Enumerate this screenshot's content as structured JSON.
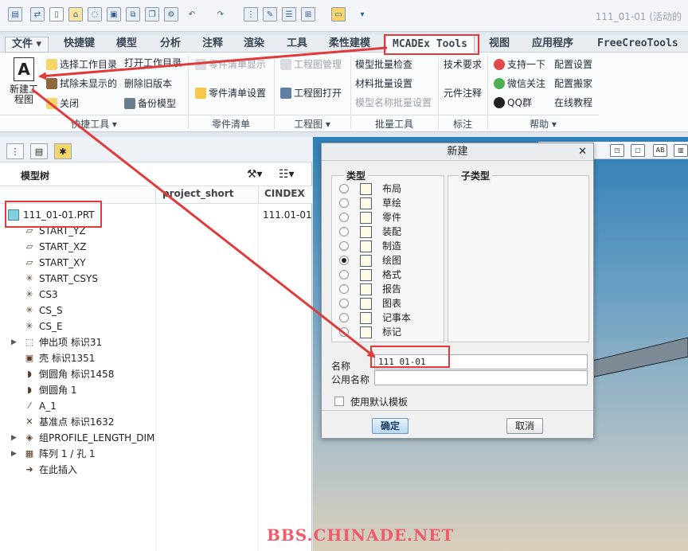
{
  "window_title": "111_01-01 (活动的",
  "tabs": [
    "文件",
    "快捷键",
    "模型",
    "分析",
    "注释",
    "渲染",
    "工具",
    "柔性建模",
    "MCADEx Tools",
    "视图",
    "应用程序",
    "FreeCreoTools"
  ],
  "ribbon": {
    "new_drawing": "新建工\n程图",
    "new_drawing_icon": "A",
    "quick": [
      "选择工作目录",
      "打开工作目录",
      "拭除未显示的",
      "删除旧版本",
      "关闭",
      "备份模型"
    ],
    "parts_list": [
      "零件清单显示",
      "零件清单设置"
    ],
    "drawing": [
      "工程图管理",
      "工程图打开"
    ],
    "batch": [
      "模型批量检查",
      "材料批量设置",
      "模型名称批量设置"
    ],
    "annotate": [
      "技术要求",
      "元件注释"
    ],
    "help": [
      "支持一下",
      "配置设置",
      "微信关注",
      "配置搬家",
      "QQ群",
      "在线教程"
    ],
    "groups": [
      "快捷工具 ▾",
      "零件清单",
      "工程图 ▾",
      "批量工具",
      "标注",
      "帮助 ▾"
    ]
  },
  "model_tree": {
    "title": "模型树",
    "columns": [
      "project_short",
      "CINDEX"
    ],
    "root": {
      "name": "111_01-01.PRT",
      "cindex": "111.01-01"
    },
    "items": [
      {
        "label": "START_YZ",
        "icon": "▱",
        "expand": false
      },
      {
        "label": "START_XZ",
        "icon": "▱",
        "expand": false
      },
      {
        "label": "START_XY",
        "icon": "▱",
        "expand": false
      },
      {
        "label": "START_CSYS",
        "icon": "✳",
        "expand": false
      },
      {
        "label": "CS3",
        "icon": "✳",
        "expand": false
      },
      {
        "label": "CS_S",
        "icon": "✳",
        "expand": false
      },
      {
        "label": "CS_E",
        "icon": "✳",
        "expand": false
      },
      {
        "label": "伸出项 标识31",
        "icon": "⬚",
        "expand": true
      },
      {
        "label": "壳 标识1351",
        "icon": "▣",
        "expand": false
      },
      {
        "label": "倒圆角 标识1458",
        "icon": "◗",
        "expand": false
      },
      {
        "label": "倒圆角 1",
        "icon": "◗",
        "expand": false
      },
      {
        "label": "A_1",
        "icon": "⁄",
        "expand": false
      },
      {
        "label": "基准点 标识1632",
        "icon": "✕",
        "expand": false
      },
      {
        "label": "组PROFILE_LENGTH_DIM",
        "icon": "◈",
        "expand": true
      },
      {
        "label": "阵列 1 / 孔 1",
        "icon": "▦",
        "expand": true
      },
      {
        "label": "在此插入",
        "icon": "➜",
        "expand": false
      }
    ]
  },
  "dialog": {
    "title": "新建",
    "type_label": "类型",
    "subtype_label": "子类型",
    "types": [
      "布局",
      "草绘",
      "零件",
      "装配",
      "制造",
      "绘图",
      "格式",
      "报告",
      "图表",
      "记事本",
      "标记"
    ],
    "selected_type": "绘图",
    "name_label": "名称",
    "name_value": "111_01-01",
    "common_name_label": "公用名称",
    "common_name_value": "",
    "use_default_template": "使用默认模板",
    "ok": "确定",
    "cancel": "取消"
  },
  "watermark": "BBS.CHINADE.NET",
  "colors": {
    "arrow": "#e03a3a",
    "accent": "#2f7fb8"
  }
}
